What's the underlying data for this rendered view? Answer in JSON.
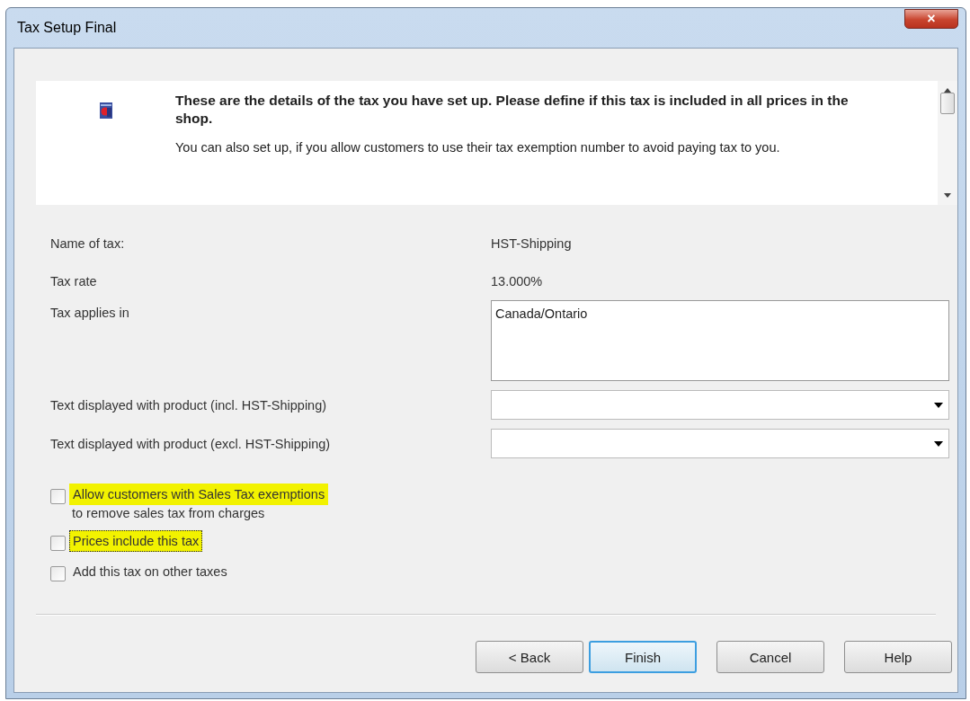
{
  "window": {
    "title": "Tax Setup Final",
    "close": "×"
  },
  "header": {
    "heading": "These are the details of the tax you have set up. Please define if this tax is included in all prices in the shop.",
    "text": "You can also set up, if you allow customers to use their tax exemption number to avoid paying tax to you."
  },
  "fields": [
    {
      "kind": "text",
      "label": "Name of tax:",
      "value": "HST-Shipping"
    },
    {
      "kind": "text",
      "label": "Tax rate",
      "value": "13.000%"
    },
    {
      "kind": "area",
      "label": "Tax applies in",
      "value": "Canada/Ontario"
    },
    {
      "kind": "dropdown",
      "label": "Text displayed with product (incl. HST-Shipping)"
    },
    {
      "kind": "dropdown",
      "label": "Text displayed with product (excl. HST-Shipping)"
    }
  ],
  "checkboxes": [
    {
      "label": "Allow customers with Sales Tax exemptions",
      "sublabel": "to remove sales tax from charges",
      "checked": false,
      "highlighted": true,
      "focused": false
    },
    {
      "label": "Prices include this tax",
      "checked": false,
      "highlighted": true,
      "focused": true
    },
    {
      "label": "Add this tax on other taxes",
      "checked": false,
      "highlighted": false,
      "focused": false
    }
  ],
  "buttons": [
    {
      "label": "< Back",
      "default": false
    },
    {
      "label": "Finish",
      "default": true
    },
    {
      "label": "Cancel",
      "default": false
    },
    {
      "label": "Help",
      "default": false
    }
  ]
}
